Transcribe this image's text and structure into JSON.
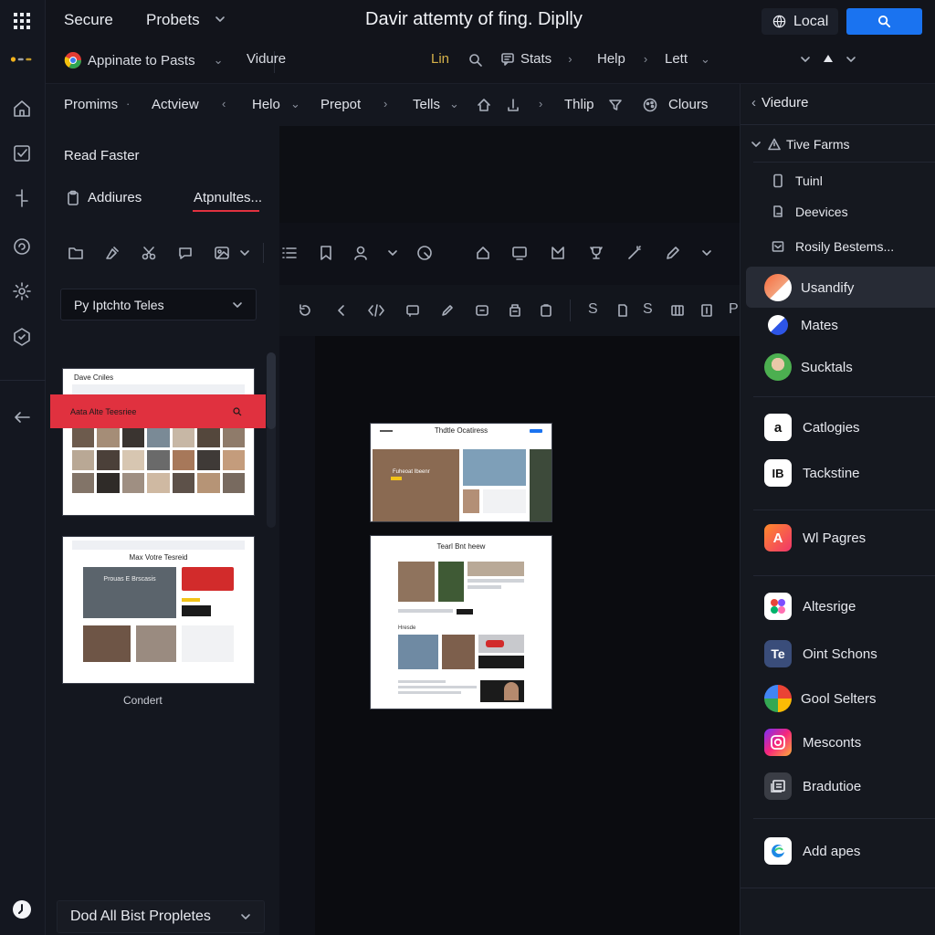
{
  "topbar": {
    "secure": "Secure",
    "probets": "Probets",
    "title": "Davir attemty of fing. Diplly",
    "local": "Local"
  },
  "bar2": {
    "appinate": "Appinate to Pasts",
    "vidure": "Vidure",
    "lin": "Lin",
    "stats": "Stats",
    "help": "Help",
    "lett": "Lett"
  },
  "bar3": {
    "items": [
      "Promims",
      "Actview",
      "Helo",
      "Prepot",
      "Tells",
      "Thlip",
      "Clours"
    ]
  },
  "left": {
    "read_faster": "Read Faster",
    "addiures": "Addiures",
    "atpnultes": "Atpnultes...",
    "dropdown": "Py Iptchto Teles",
    "thumb1_title": "Dave Cniles",
    "thumb1_banner": "Aata Alte Teesriee",
    "thumb2_title": "Max Votre Tesreid",
    "thumb2_hero": "Prouas E Brscasis",
    "caption": "Condert",
    "bottom_dropdown": "Dod All Bist Propletes"
  },
  "canvas": {
    "card1_title": "Thdtle Ocatiress",
    "card1_caption": "Fuheoat Ibeenr",
    "card2_title": "Tearl Bnt heew",
    "card2_label": "Hresde"
  },
  "right": {
    "header": "Viedure",
    "group": "Tive Farms",
    "items": [
      "Tuinl",
      "Deevices",
      "Rosily Bestems..."
    ],
    "apps": [
      "Usandify",
      "Mates",
      "Sucktals",
      "Catlogies",
      "Tackstine",
      "Wl Pagres",
      "Altesrige",
      "Oint Schons",
      "Gool Selters",
      "Mesconts",
      "Bradutioe",
      "Add apes"
    ]
  },
  "colors": {
    "accent_blue": "#1a73f0",
    "accent_red": "#e0313f",
    "panel": "#15181f"
  }
}
